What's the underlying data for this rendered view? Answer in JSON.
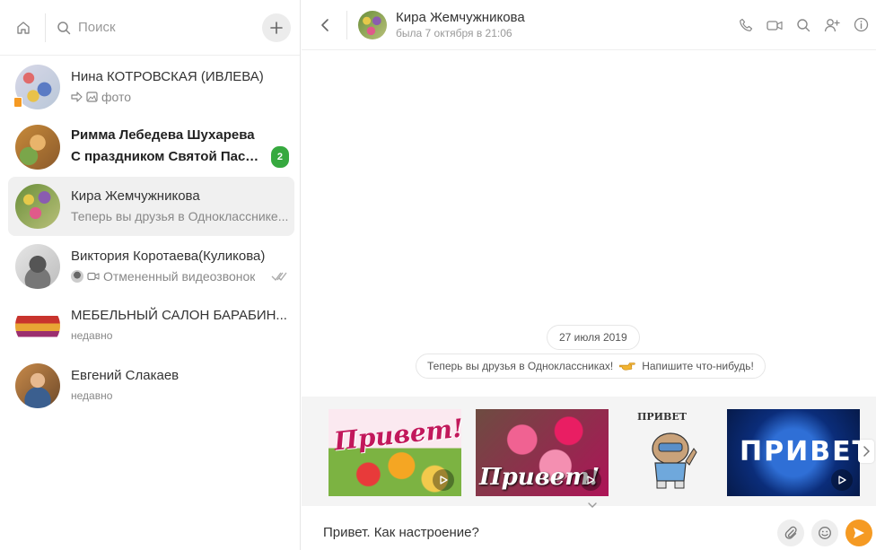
{
  "left": {
    "search_placeholder": "Поиск",
    "chats": [
      {
        "name": "Нина КОТРОВСКАЯ (ИВЛЕВА)",
        "sub": "фото",
        "bold": false
      },
      {
        "name": "Римма Лебедева Шухарева",
        "sub": "С праздником Святой Пасхи...",
        "bold": true,
        "unread": "2"
      },
      {
        "name": "Кира Жемчужникова",
        "sub": "Теперь вы друзья в Однокласснике...",
        "active": true
      },
      {
        "name": "Виктория Коротаева(Куликова)",
        "sub": "Отмененный видеозвонок"
      },
      {
        "name": "МЕБЕЛЬНЫЙ САЛОН БАРАБИН...",
        "sub": "недавно"
      },
      {
        "name": "Евгений Слакаев",
        "sub": "недавно"
      }
    ]
  },
  "header": {
    "name": "Кира Жемчужникова",
    "status": "была 7 октября в 21:06"
  },
  "messages": {
    "date": "27 июля 2019",
    "system_text_1": "Теперь вы друзья в Одноклассниках!",
    "system_text_2": "Напишите что-нибудь!"
  },
  "stickers": [
    {
      "text": "Привет!"
    },
    {
      "text": "Привет!"
    },
    {
      "text": "ПРИВЕТ"
    },
    {
      "text": "ПРИВЕТ"
    }
  ],
  "composer": {
    "value": "Привет. Как настроение?"
  },
  "colors": {
    "accent": "#f59a23",
    "unread": "#36a93f"
  }
}
